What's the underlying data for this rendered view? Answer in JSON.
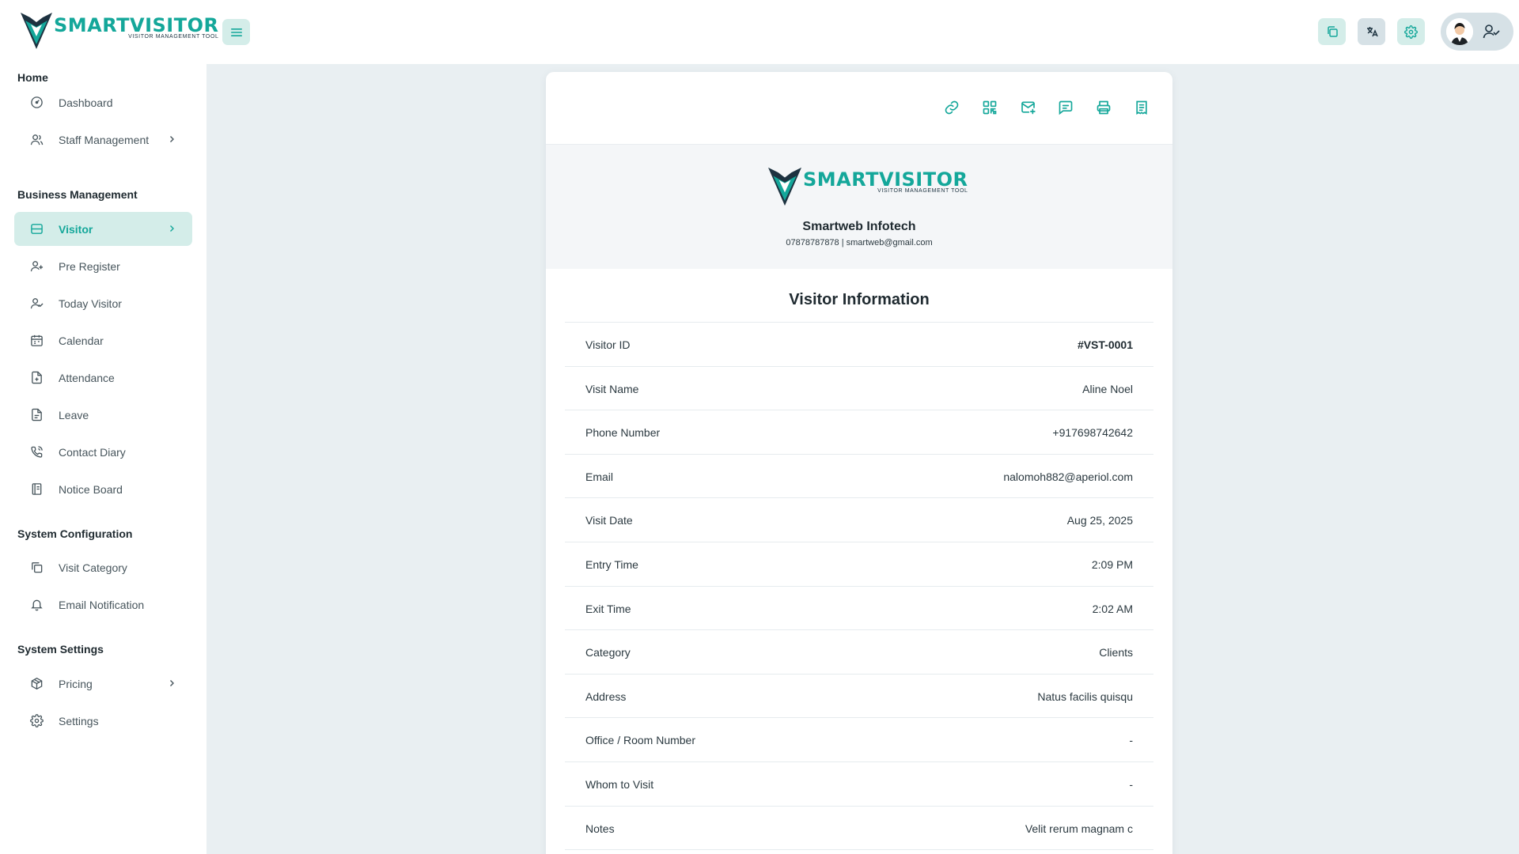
{
  "brand": {
    "logo_text": "SMARTVISITOR",
    "logo_tagline": "VISITOR MANAGEMENT TOOL",
    "accent": "#14a79a",
    "dark": "#1d3240"
  },
  "topbar": {
    "menu_icon": "hamburger-icon",
    "icons": [
      "copy-icon",
      "translate-icon",
      "settings-gear-icon"
    ],
    "user_icon": "user-check-icon"
  },
  "sidebar": {
    "sections": [
      {
        "title": "Home",
        "items": [
          {
            "label": "Dashboard",
            "icon": "gauge-icon"
          },
          {
            "label": "Staff Management",
            "icon": "users-icon",
            "chevron": true
          }
        ]
      },
      {
        "title": "Business Management",
        "items": [
          {
            "label": "Visitor",
            "icon": "id-card-icon",
            "chevron": true,
            "active": true
          },
          {
            "label": "Pre Register",
            "icon": "user-plus-icon"
          },
          {
            "label": "Today Visitor",
            "icon": "user-check-icon"
          },
          {
            "label": "Calendar",
            "icon": "calendar-icon"
          },
          {
            "label": "Attendance",
            "icon": "file-plus-icon"
          },
          {
            "label": "Leave",
            "icon": "file-icon"
          },
          {
            "label": "Contact Diary",
            "icon": "phone-call-icon"
          },
          {
            "label": "Notice Board",
            "icon": "notebook-icon"
          }
        ]
      },
      {
        "title": "System Configuration",
        "items": [
          {
            "label": "Visit Category",
            "icon": "layers-icon"
          },
          {
            "label": "Email Notification",
            "icon": "bell-icon"
          }
        ]
      },
      {
        "title": "System Settings",
        "items": [
          {
            "label": "Pricing",
            "icon": "package-icon",
            "chevron": true
          },
          {
            "label": "Settings",
            "icon": "gear-icon"
          }
        ]
      }
    ]
  },
  "card": {
    "actions": [
      "link-icon",
      "qr-code-icon",
      "mail-send-icon",
      "message-icon",
      "printer-icon",
      "receipt-icon"
    ],
    "company": {
      "name": "Smartweb Infotech",
      "contact": "07878787878 | smartweb@gmail.com"
    },
    "info_title": "Visitor Information",
    "rows": [
      {
        "label": "Visitor ID",
        "value": "#VST-0001",
        "bold": true
      },
      {
        "label": "Visit Name",
        "value": "Aline Noel"
      },
      {
        "label": "Phone Number",
        "value": "+917698742642"
      },
      {
        "label": "Email",
        "value": "nalomoh882@aperiol.com"
      },
      {
        "label": "Visit Date",
        "value": "Aug 25, 2025"
      },
      {
        "label": "Entry Time",
        "value": "2:09 PM"
      },
      {
        "label": "Exit Time",
        "value": "2:02 AM"
      },
      {
        "label": "Category",
        "value": "Clients"
      },
      {
        "label": "Address",
        "value": "Natus facilis quisqu"
      },
      {
        "label": "Office / Room Number",
        "value": "-"
      },
      {
        "label": "Whom to Visit",
        "value": "-"
      },
      {
        "label": "Notes",
        "value": "Velit rerum magnam c"
      }
    ]
  }
}
